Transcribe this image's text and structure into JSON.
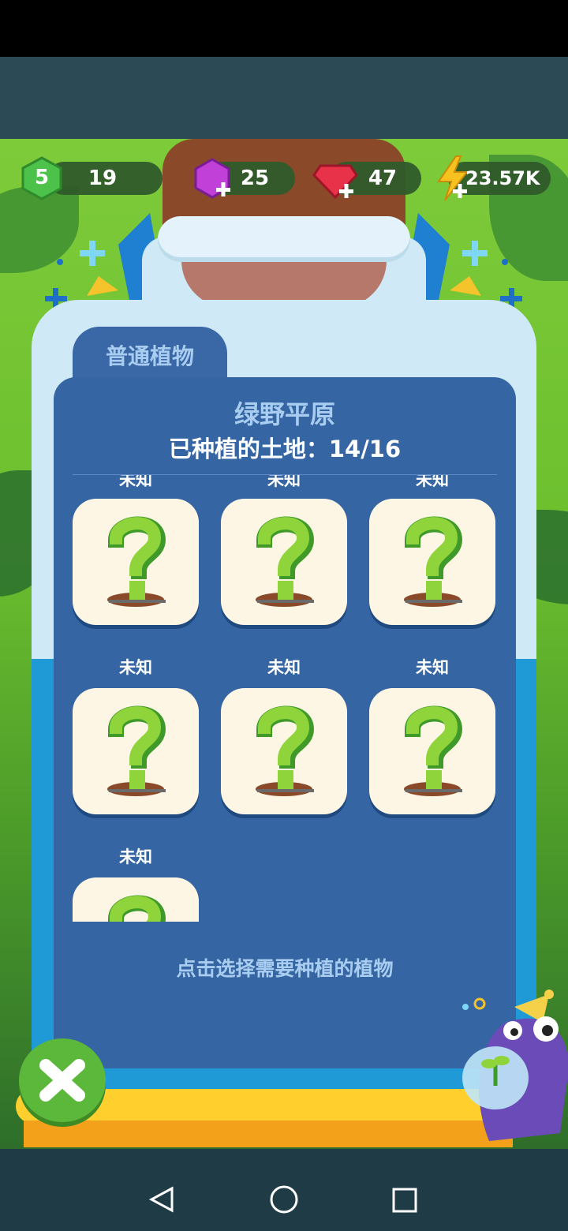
{
  "hud": {
    "level": "5",
    "xp": "19",
    "purple_gems": "25",
    "red_gems": "47",
    "energy": "23.57K",
    "icons": [
      "level-hex-icon",
      "purple-gem-plus-icon",
      "red-gem-plus-icon",
      "lightning-plus-icon"
    ]
  },
  "panel": {
    "tab_label": "普通植物",
    "title": "绿野平原",
    "subtitle": "已种植的土地：14/16",
    "partial_row_labels": [
      "未知",
      "未知",
      "未知"
    ],
    "cells": [
      {
        "label": "未知"
      },
      {
        "label": "未知"
      },
      {
        "label": "未知"
      },
      {
        "label": "未知"
      },
      {
        "label": "未知"
      },
      {
        "label": "未知"
      },
      {
        "label": "未知"
      }
    ],
    "hint": "点击选择需要种植的植物"
  },
  "colors": {
    "panel_bg": "#3565a3",
    "card_bg": "#fdf6e4",
    "question_green": "#8fd43a",
    "close_button": "#5bb83a"
  },
  "navbar": {
    "icons": [
      "back-triangle-icon",
      "home-circle-icon",
      "recents-square-icon"
    ]
  }
}
